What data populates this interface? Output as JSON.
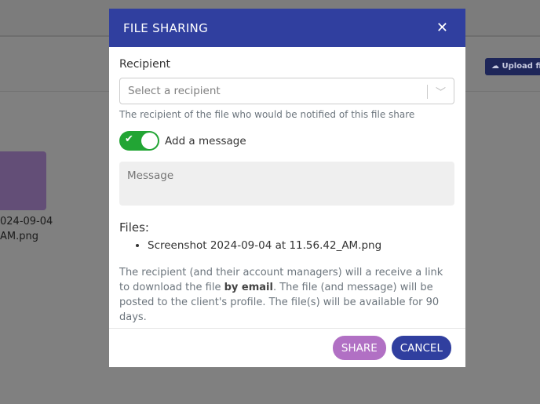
{
  "background": {
    "upload_button": "Upload fil",
    "file_name_line1": "024-09-04",
    "file_name_line2": "AM.png"
  },
  "modal": {
    "title": "FILE SHARING",
    "recipient_label": "Recipient",
    "recipient_placeholder": "Select a recipient",
    "recipient_help": "The recipient of the file who would be notified of this file share",
    "add_message_label": "Add a message",
    "add_message_enabled": true,
    "message_placeholder": "Message",
    "files_label": "Files:",
    "files": [
      "Screenshot 2024-09-04 at 11.56.42_AM.png"
    ],
    "note_part1": "The recipient (and their account managers) will a receive a link to download the file ",
    "note_bold": "by email",
    "note_part2": ". The file (and message) will be posted to the client's profile. The file(s) will be available for 90 days.",
    "share_label": "SHARE",
    "cancel_label": "CANCEL"
  },
  "colors": {
    "header": "#303f9f",
    "toggle": "#22a534",
    "share": "#b170c4",
    "cancel": "#303f9f"
  }
}
